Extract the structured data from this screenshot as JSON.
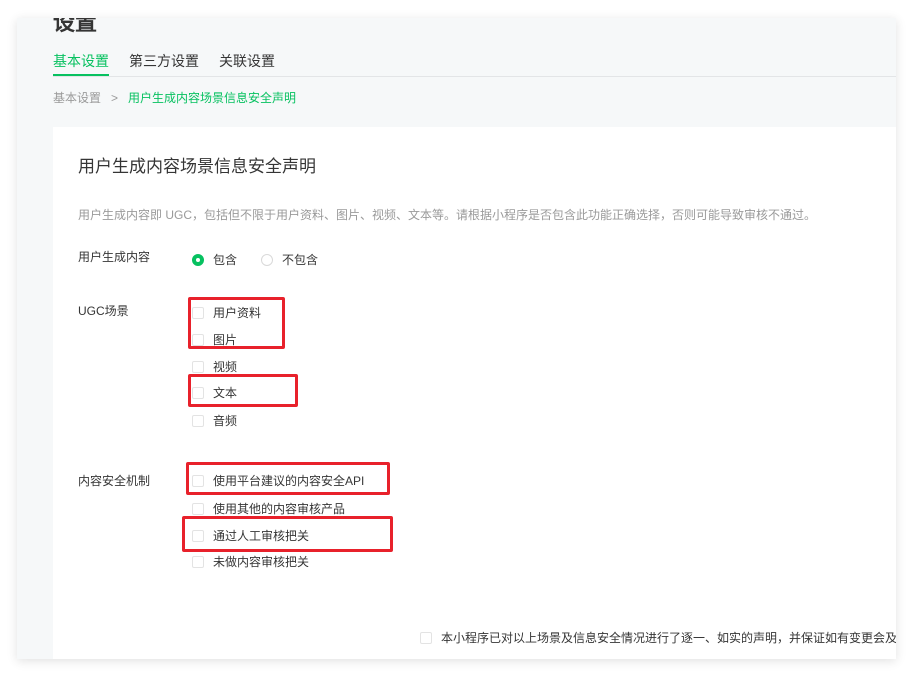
{
  "page": {
    "title": "设置"
  },
  "tabs": [
    {
      "label": "基本设置",
      "active": true
    },
    {
      "label": "第三方设置",
      "active": false
    },
    {
      "label": "关联设置",
      "active": false
    }
  ],
  "breadcrumb": {
    "parent": "基本设置",
    "separator": ">",
    "current": "用户生成内容场景信息安全声明"
  },
  "card": {
    "title": "用户生成内容场景信息安全声明",
    "description": "用户生成内容即 UGC，包括但不限于用户资料、图片、视频、文本等。请根据小程序是否包含此功能正确选择，否则可能导致审核不通过。"
  },
  "ugc_content": {
    "label": "用户生成内容",
    "options": [
      {
        "label": "包含",
        "checked": true
      },
      {
        "label": "不包含",
        "checked": false
      }
    ]
  },
  "ugc_scenes": {
    "label": "UGC场景",
    "items": [
      {
        "label": "用户资料",
        "checked": false
      },
      {
        "label": "图片",
        "checked": false
      },
      {
        "label": "视频",
        "checked": false
      },
      {
        "label": "文本",
        "checked": false
      },
      {
        "label": "音频",
        "checked": false
      }
    ]
  },
  "security": {
    "label": "内容安全机制",
    "items": [
      {
        "label": "使用平台建议的内容安全API",
        "checked": false
      },
      {
        "label": "使用其他的内容审核产品",
        "checked": false
      },
      {
        "label": "通过人工审核把关",
        "checked": false
      },
      {
        "label": "未做内容审核把关",
        "checked": false
      }
    ]
  },
  "declaration": {
    "label": "本小程序已对以上场景及信息安全情况进行了逐一、如实的声明，并保证如有变更会及时"
  },
  "colors": {
    "accent": "#07c160",
    "highlight": "#e8212b",
    "text": "#353535",
    "muted": "#9a9a9a"
  }
}
